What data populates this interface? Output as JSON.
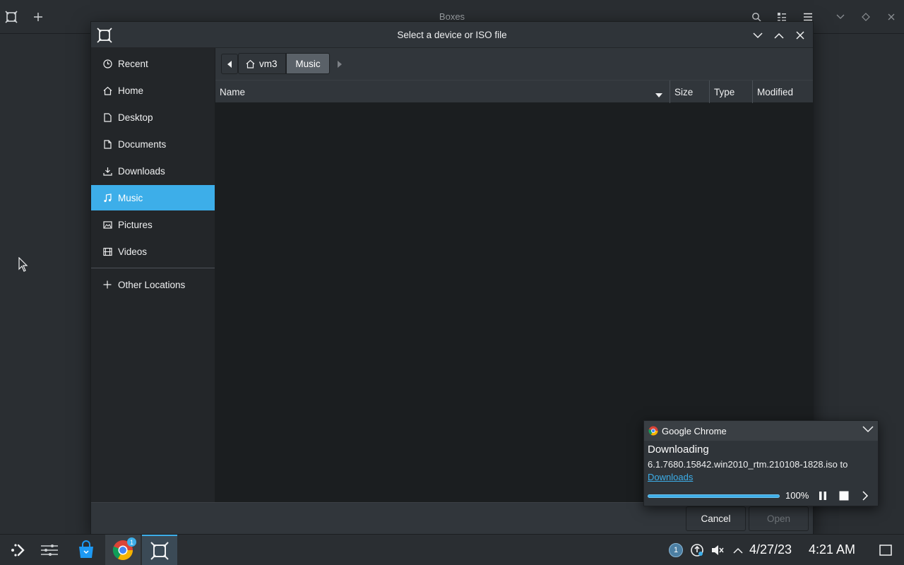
{
  "background_window": {
    "title": "Boxes",
    "add_icon": "plus-icon",
    "search_icon": "search-icon",
    "view_icon": "view-mode-icon",
    "menu_icon": "hamburger-icon"
  },
  "dialog": {
    "title": "Select a device or ISO file",
    "sidebar": [
      {
        "label": "Recent",
        "icon": "clock-icon"
      },
      {
        "label": "Home",
        "icon": "home-icon"
      },
      {
        "label": "Desktop",
        "icon": "folder-icon"
      },
      {
        "label": "Documents",
        "icon": "document-icon"
      },
      {
        "label": "Downloads",
        "icon": "download-icon"
      },
      {
        "label": "Music",
        "icon": "music-icon",
        "active": true
      },
      {
        "label": "Pictures",
        "icon": "image-icon"
      },
      {
        "label": "Videos",
        "icon": "film-icon"
      }
    ],
    "other_locations": "Other Locations",
    "path": {
      "home": "vm3",
      "current": "Music"
    },
    "columns": {
      "name": "Name",
      "size": "Size",
      "type": "Type",
      "modified": "Modified"
    },
    "cancel_label": "Cancel",
    "open_label": "Open"
  },
  "notification": {
    "app": "Google Chrome",
    "title": "Downloading",
    "filename": "6.1.7680.15842.win2010_rtm.210108-1828.iso to",
    "link": "Downloads",
    "progress_percent": "100%",
    "progress_value": 1.0
  },
  "taskbar": {
    "date": "4/27/23",
    "time": "4:21 AM",
    "chrome_badge": "1",
    "tray_badge": "1"
  },
  "colors": {
    "accent": "#3daee9",
    "background": "#2a2e32",
    "view_background": "#1b1e20"
  }
}
